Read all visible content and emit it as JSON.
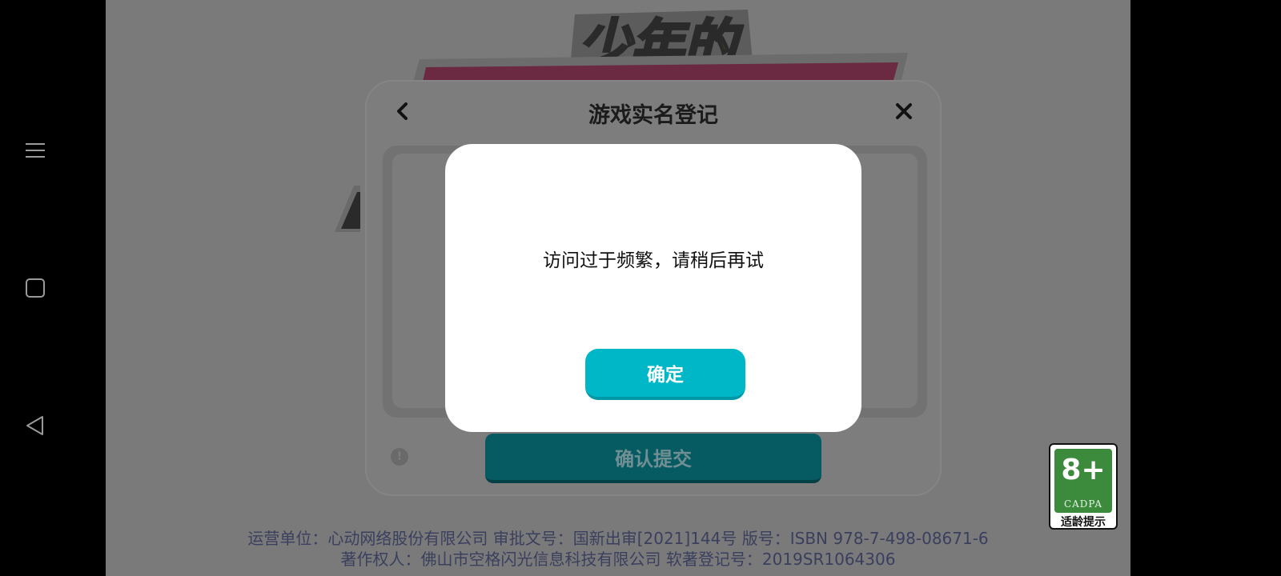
{
  "system_nav": {
    "menu_icon": "menu-icon",
    "home_icon": "square-home-icon",
    "back_icon": "triangle-back-icon"
  },
  "game": {
    "logo_text": "少年的"
  },
  "registration": {
    "title": "游戏实名登记",
    "back_icon": "chevron-left-icon",
    "close_icon": "close-icon",
    "info_icon": "info-icon",
    "submit_label": "确认提交"
  },
  "modal": {
    "message": "访问过于频繁，请稍后再试",
    "ok_label": "确定"
  },
  "footer": {
    "line1": "运营单位：心动网络股份有限公司 审批文号：国新出审[2021]144号 版号：ISBN 978-7-498-08671-6",
    "line2": "著作权人：佛山市空格闪光信息科技有限公司 软著登记号：2019SR1064306"
  },
  "age_rating": {
    "age": "8+",
    "org": "CADPA",
    "label": "适龄提示"
  },
  "colors": {
    "accent": "#00b7c8",
    "submit_dimmed": "#065a62",
    "badge_green": "#3c8a3c"
  }
}
